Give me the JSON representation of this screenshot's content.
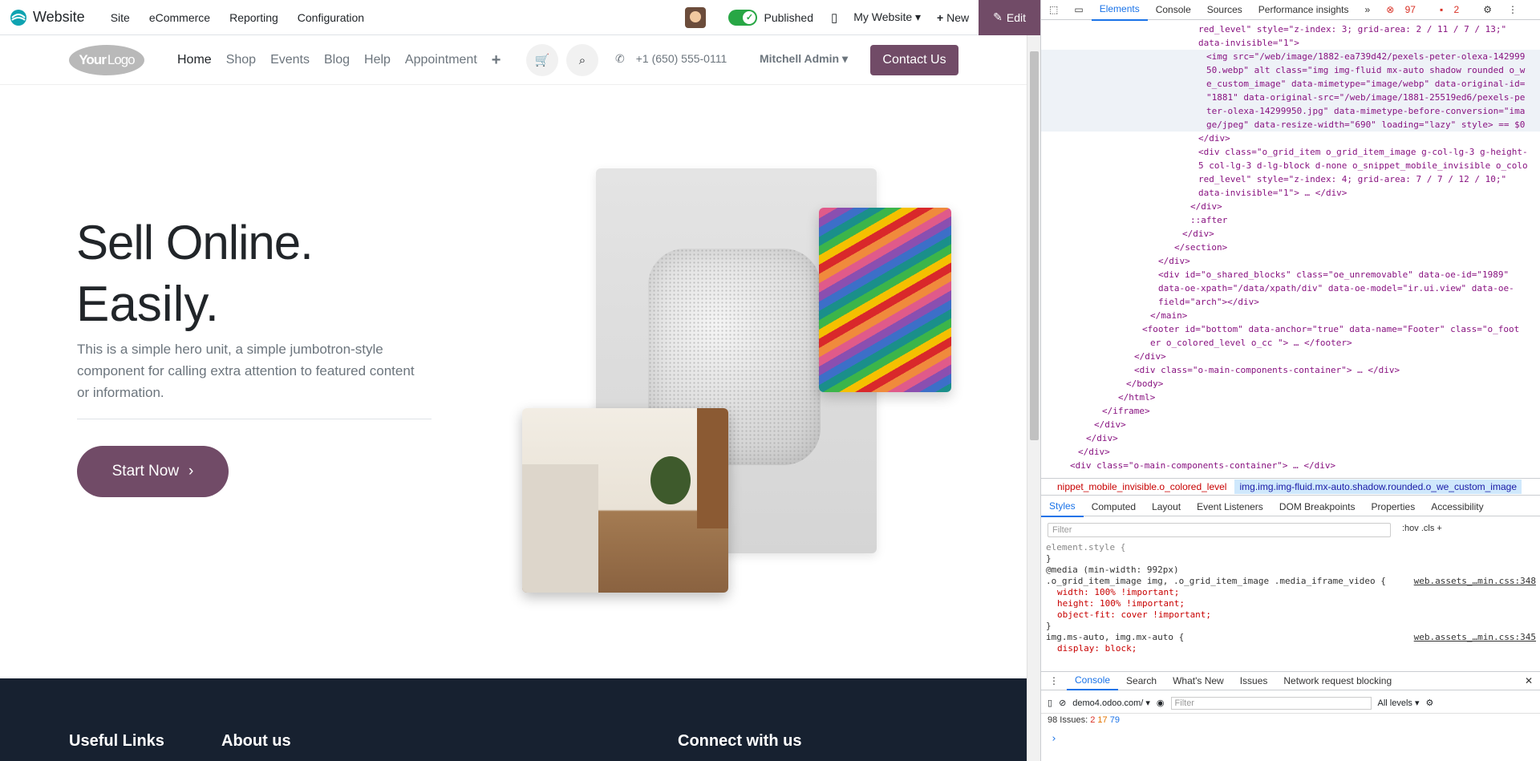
{
  "topbar": {
    "brand": "Website",
    "menu": [
      "Site",
      "eCommerce",
      "Reporting",
      "Configuration"
    ],
    "published": "Published",
    "website_select": "My Website",
    "new_label": "New",
    "edit_label": "Edit"
  },
  "header": {
    "logo_text": "Your",
    "logo_text2": "Logo",
    "nav": [
      "Home",
      "Shop",
      "Events",
      "Blog",
      "Help",
      "Appointment"
    ],
    "phone": "+1 (650) 555-0111",
    "user": "Mitchell Admin",
    "contact": "Contact Us"
  },
  "hero": {
    "title_line1": "Sell Online.",
    "title_line2": "Easily.",
    "lead": "This is a simple hero unit, a simple jumbotron-style component for calling extra attention to featured content or information.",
    "cta": "Start Now"
  },
  "footer": {
    "col1": "Useful Links",
    "col2": "About us",
    "col3": "Connect with us"
  },
  "devtools": {
    "tabs": [
      "Elements",
      "Console",
      "Sources",
      "Performance insights"
    ],
    "error_count": "97",
    "warn_count": "2",
    "code_lines": [
      "red_level\" style=\"z-index: 3; grid-area: 2 / 11 / 7 / 13;\"",
      "data-invisible=\"1\">",
      "<img src=\"/web/image/1882-ea739d42/pexels-peter-olexa-142999",
      "50.webp\" alt class=\"img img-fluid mx-auto shadow rounded o_w",
      "e_custom_image\" data-mimetype=\"image/webp\" data-original-id=",
      "\"1881\" data-original-src=\"/web/image/1881-25519ed6/pexels-pe",
      "ter-olexa-14299950.jpg\" data-mimetype-before-conversion=\"ima",
      "ge/jpeg\" data-resize-width=\"690\" loading=\"lazy\" style> == $0",
      "</div>",
      "<div class=\"o_grid_item o_grid_item_image g-col-lg-3 g-height-",
      "5 col-lg-3 d-lg-block d-none o_snippet_mobile_invisible o_colo",
      "red_level\" style=\"z-index: 4; grid-area: 7 / 7 / 12 / 10;\"",
      "data-invisible=\"1\"> … </div>",
      "</div>",
      "::after",
      "</div>",
      "</section>",
      "</div>",
      "<div id=\"o_shared_blocks\" class=\"oe_unremovable\" data-oe-id=\"1989\"",
      "data-oe-xpath=\"/data/xpath/div\" data-oe-model=\"ir.ui.view\" data-oe-",
      "field=\"arch\"></div>",
      "</main>",
      "<footer id=\"bottom\" data-anchor=\"true\" data-name=\"Footer\" class=\"o_foot",
      "er o_colored_level o_cc \"> … </footer>",
      "</div>",
      "<div class=\"o-main-components-container\"> … </div>",
      "</body>",
      "</html>",
      "</iframe>",
      "</div>",
      "</div>",
      "</div>",
      "<div class=\"o-main-components-container\"> … </div>"
    ],
    "breadcrumb1": "nippet_mobile_invisible.o_colored_level",
    "breadcrumb2": "img.img.img-fluid.mx-auto.shadow.rounded.o_we_custom_image",
    "style_tabs": [
      "Styles",
      "Computed",
      "Layout",
      "Event Listeners",
      "DOM Breakpoints",
      "Properties",
      "Accessibility"
    ],
    "filter_placeholder": "Filter",
    "hov": ":hov",
    "cls": ".cls",
    "css_lines": [
      "element.style {",
      "}",
      "@media (min-width: 992px)",
      ".o_grid_item_image img, .o_grid_item_image .media_iframe_video {",
      "width: 100% !important;",
      "height: 100% !important;",
      "object-fit: cover !important;",
      "}",
      "img.ms-auto, img.mx-auto {",
      "display: block;"
    ],
    "css_src1": "web.assets_…min.css:348",
    "css_src2": "web.assets_…min.css:345",
    "console_tabs": [
      "Console",
      "Search",
      "What's New",
      "Issues",
      "Network request blocking"
    ],
    "context": "demo4.odoo.com/",
    "console_filter": "Filter",
    "levels": "All levels",
    "issues_label": "98 Issues:",
    "issues_err": "2",
    "issues_warn": "17",
    "issues_info": "79"
  },
  "colors": {
    "primary": "#714b67",
    "footer": "#172130",
    "published": "#28a745"
  }
}
